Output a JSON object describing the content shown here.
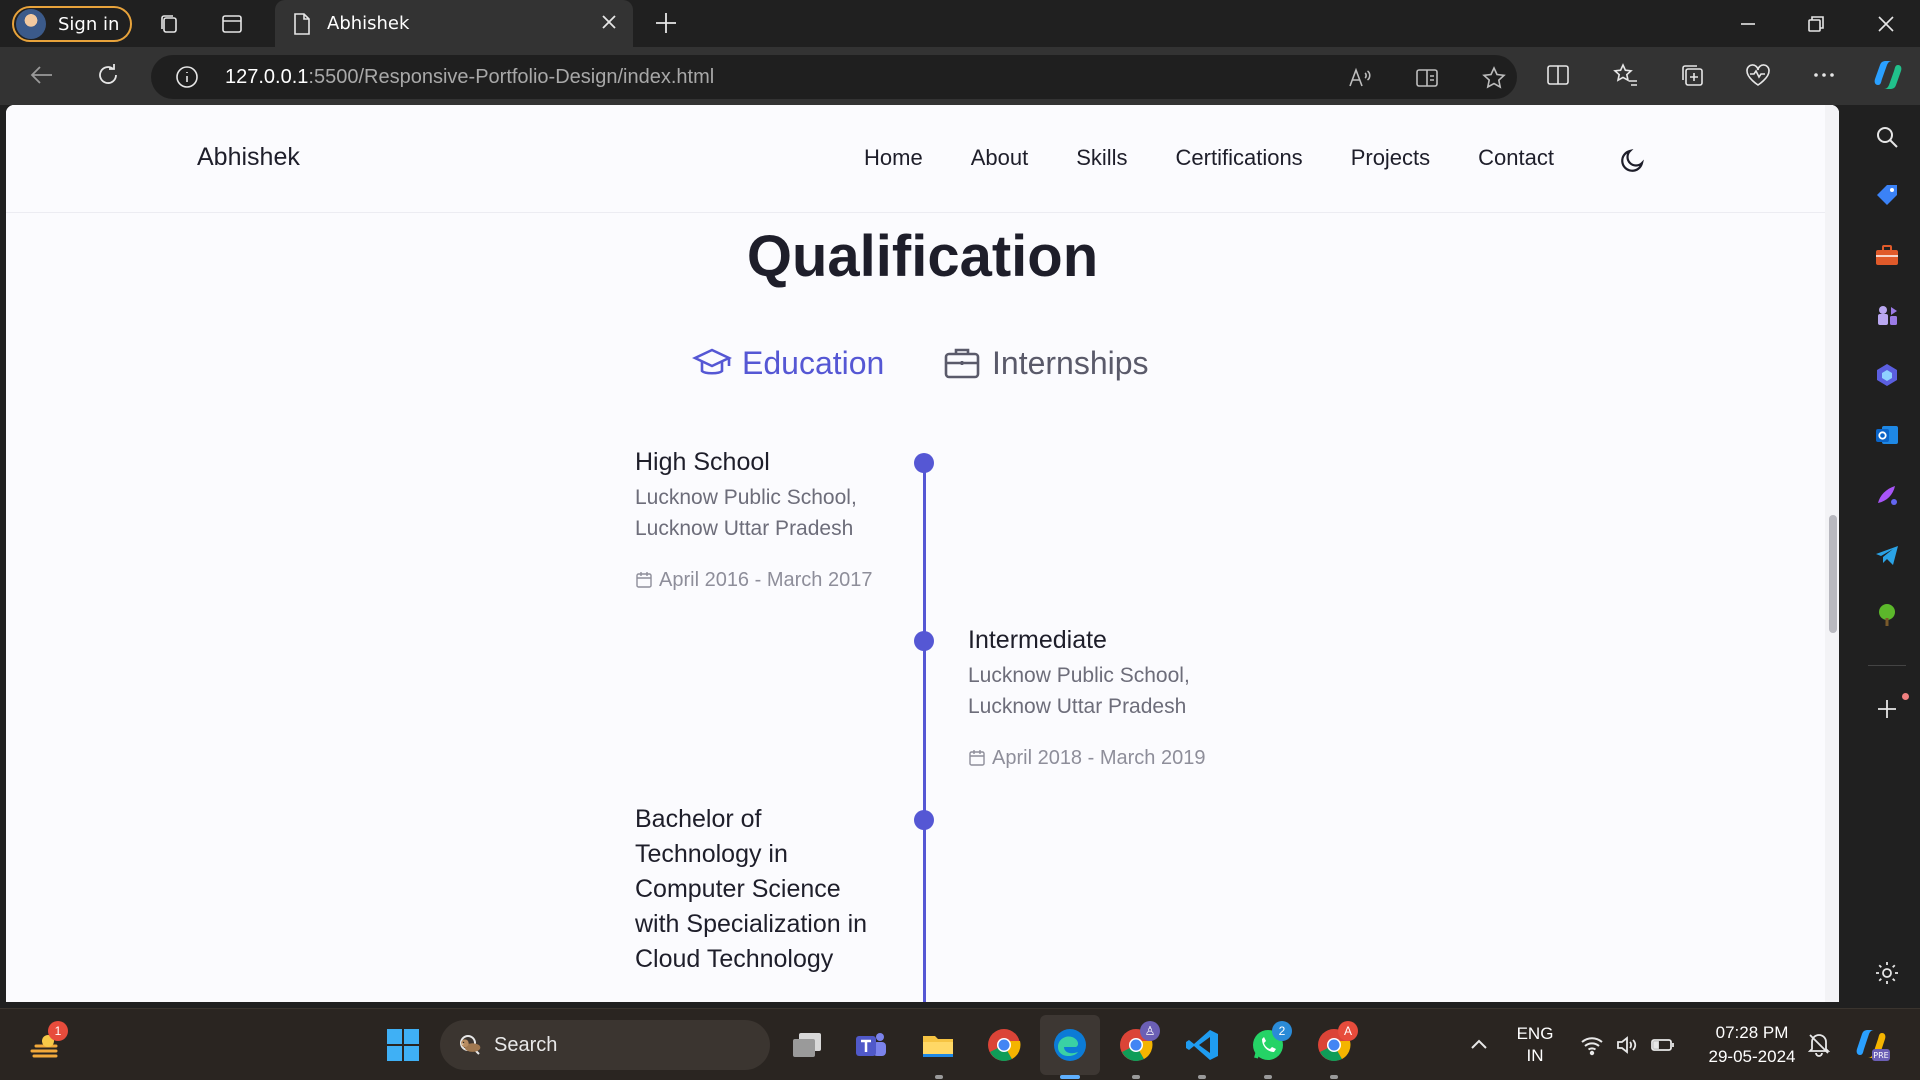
{
  "browser": {
    "signin_label": "Sign in",
    "tab_title": "Abhishek",
    "url_host": "127.0.0.1",
    "url_path": ":5500/Responsive-Portfolio-Design/index.html"
  },
  "site": {
    "logo": "Abhishek",
    "nav": [
      "Home",
      "About",
      "Skills",
      "Certifications",
      "Projects",
      "Contact"
    ],
    "section_title": "Qualification",
    "tabs": {
      "education": "Education",
      "internships": "Internships"
    },
    "qualifications": [
      {
        "title": "High School",
        "subtitle": "Lucknow Public School, Lucknow Uttar Pradesh",
        "date": "April 2016 - March 2017"
      },
      {
        "title": "Intermediate",
        "subtitle": "Lucknow Public School, Lucknow Uttar Pradesh",
        "date": "April 2018 - March 2019"
      },
      {
        "title": "Bachelor of Technology in Computer Science with Specialization in Cloud Technology",
        "subtitle": "",
        "date": ""
      }
    ]
  },
  "taskbar": {
    "search_placeholder": "Search",
    "weather_badge": "1",
    "teams_badge": "",
    "whatsapp_badge": "2",
    "chrome2_badge": "A",
    "lang_line1": "ENG",
    "lang_line2": "IN",
    "time": "07:28 PM",
    "date": "29-05-2024"
  },
  "colors": {
    "accent": "#5557d4",
    "text": "#1e1e2a",
    "muted": "#6d6d7a"
  }
}
